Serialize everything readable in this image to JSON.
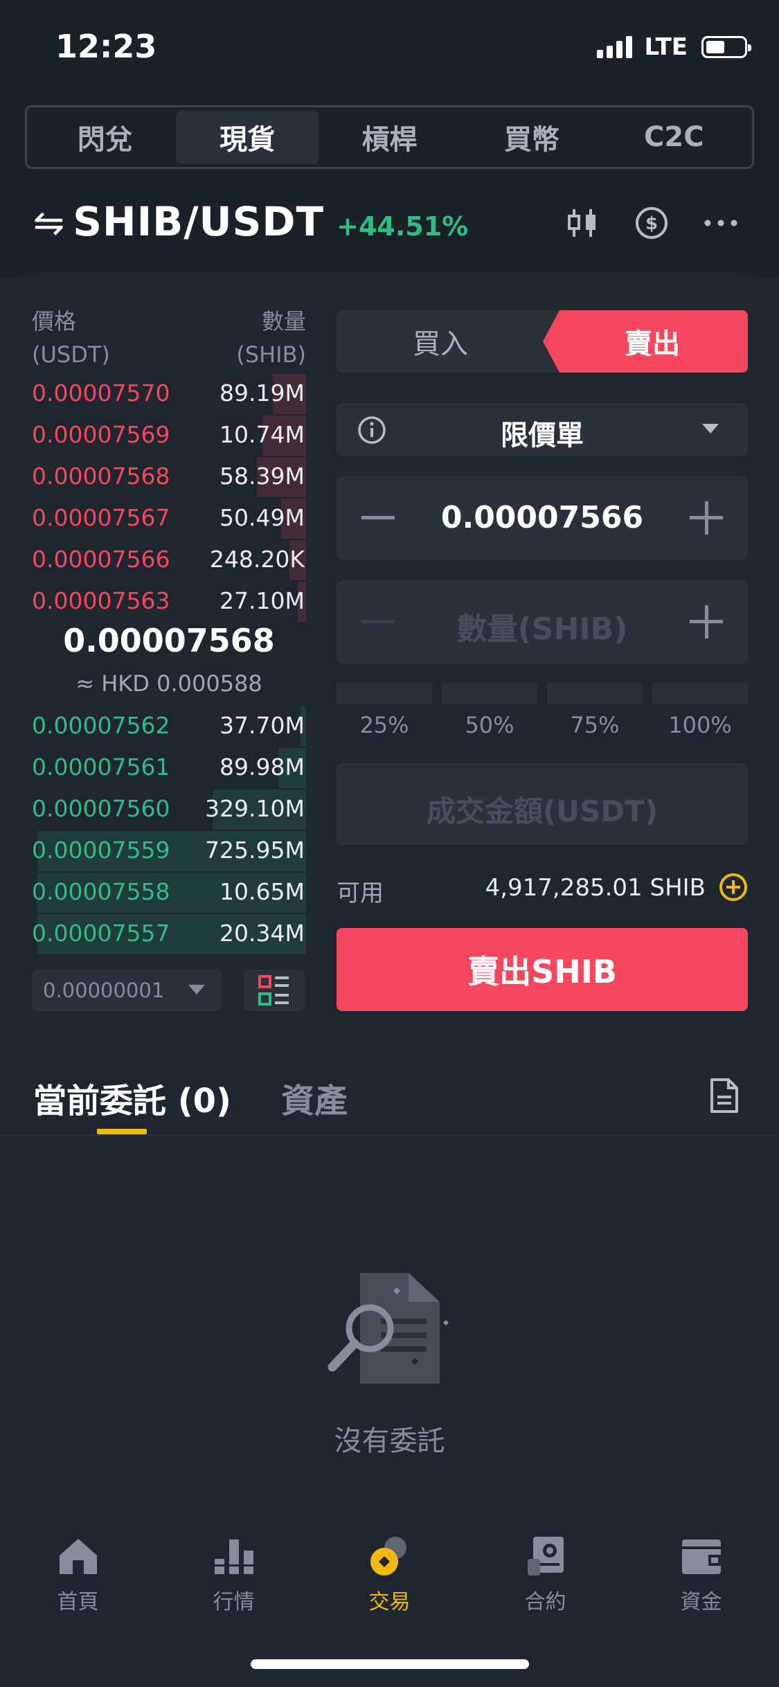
{
  "status_bar": {
    "time": "12:23",
    "network": "LTE"
  },
  "top_tabs": [
    {
      "label": "閃兌",
      "active": false
    },
    {
      "label": "現貨",
      "active": true
    },
    {
      "label": "槓桿",
      "active": false
    },
    {
      "label": "買幣",
      "active": false
    },
    {
      "label": "C2C",
      "active": false
    }
  ],
  "pair": {
    "swap_symbol": "⇋",
    "name": "SHIB/USDT",
    "change": "+44.51%"
  },
  "header_icons": [
    "candlestick-chart-icon",
    "dollar-coin-icon",
    "more-icon"
  ],
  "order_book": {
    "price_header": "價格",
    "price_unit": "(USDT)",
    "qty_header": "數量",
    "qty_unit": "(SHIB)",
    "asks": [
      {
        "price": "0.00007570",
        "qty": "89.19M",
        "depth": 0.12
      },
      {
        "price": "0.00007569",
        "qty": "10.74M",
        "depth": 0.16
      },
      {
        "price": "0.00007568",
        "qty": "58.39M",
        "depth": 0.18
      },
      {
        "price": "0.00007567",
        "qty": "50.49M",
        "depth": 0.09
      },
      {
        "price": "0.00007566",
        "qty": "248.20K",
        "depth": 0.06
      },
      {
        "price": "0.00007563",
        "qty": "27.10M",
        "depth": 0.03
      }
    ],
    "mid_price": "0.00007568",
    "mid_hkd": "≈ HKD  0.000588",
    "bids": [
      {
        "price": "0.00007562",
        "qty": "37.70M",
        "depth": 0.02
      },
      {
        "price": "0.00007561",
        "qty": "89.98M",
        "depth": 0.1
      },
      {
        "price": "0.00007560",
        "qty": "329.10M",
        "depth": 0.34
      },
      {
        "price": "0.00007559",
        "qty": "725.95M",
        "depth": 0.98
      },
      {
        "price": "0.00007558",
        "qty": "10.65M",
        "depth": 0.98
      },
      {
        "price": "0.00007557",
        "qty": "20.34M",
        "depth": 0.98
      }
    ],
    "tick_size": "0.00000001"
  },
  "trade_form": {
    "buy_label": "買入",
    "sell_label": "賣出",
    "order_type": "限價單",
    "price_value": "0.00007566",
    "amount_placeholder": "數量(SHIB)",
    "percents": [
      "25%",
      "50%",
      "75%",
      "100%"
    ],
    "total_placeholder": "成交金額(USDT)",
    "available_label": "可用",
    "available_value": "4,917,285.01 SHIB",
    "submit_label": "賣出SHIB"
  },
  "orders": {
    "tabs": [
      {
        "label": "當前委託 (0)",
        "active": true
      },
      {
        "label": "資產",
        "active": false
      }
    ],
    "empty_text": "沒有委託"
  },
  "bottom_nav": [
    {
      "label": "首頁",
      "icon": "home-icon",
      "active": false
    },
    {
      "label": "行情",
      "icon": "markets-icon",
      "active": false
    },
    {
      "label": "交易",
      "icon": "trade-icon",
      "active": true
    },
    {
      "label": "合約",
      "icon": "futures-icon",
      "active": false
    },
    {
      "label": "資金",
      "icon": "wallet-icon",
      "active": false
    }
  ],
  "colors": {
    "red": "#f6465d",
    "green": "#2ebd85",
    "accent": "#f0b90b",
    "background": "#1f2630"
  }
}
